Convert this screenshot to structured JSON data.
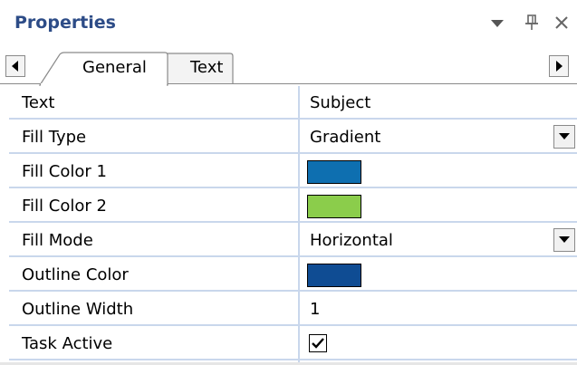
{
  "panel": {
    "title": "Properties"
  },
  "tabs": [
    {
      "label": "General",
      "active": true
    },
    {
      "label": "Text",
      "active": false
    }
  ],
  "properties": [
    {
      "label": "Text",
      "value": "Subject",
      "type": "text"
    },
    {
      "label": "Fill Type",
      "value": "Gradient",
      "type": "dropdown"
    },
    {
      "label": "Fill Color 1",
      "color": "#0e6fb0",
      "type": "color"
    },
    {
      "label": "Fill Color 2",
      "color": "#8bcd4b",
      "type": "color"
    },
    {
      "label": "Fill Mode",
      "value": "Horizontal",
      "type": "dropdown"
    },
    {
      "label": "Outline Color",
      "color": "#0f4c93",
      "type": "color"
    },
    {
      "label": "Outline Width",
      "value": "1",
      "type": "text"
    },
    {
      "label": "Task Active",
      "checked": true,
      "type": "checkbox"
    }
  ],
  "colors": {
    "title_text": "#2d4c87",
    "grid_line": "#c9d7ec"
  }
}
